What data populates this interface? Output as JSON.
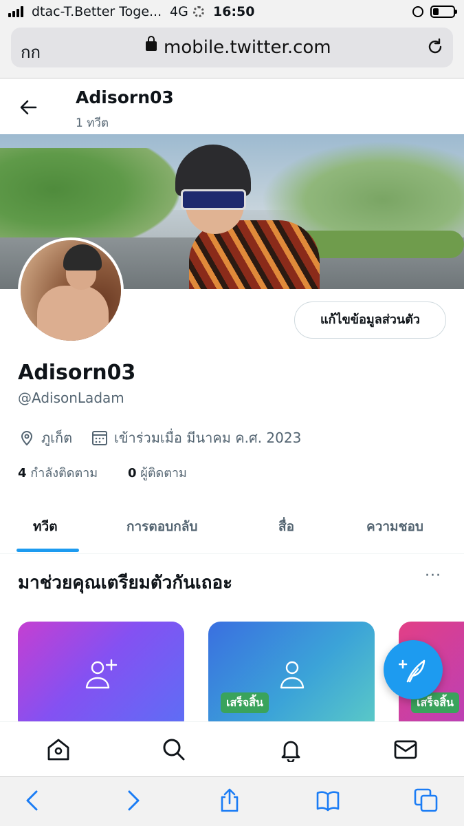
{
  "status_bar": {
    "carrier": "dtac-T.Better Toge...",
    "network": "4G",
    "time": "16:50"
  },
  "browser": {
    "aa_label": "กก",
    "domain": "mobile.twitter.com"
  },
  "header": {
    "name": "Adisorn03",
    "tweet_count": "1 ทวีต"
  },
  "profile": {
    "name": "Adisorn03",
    "handle": "@AdisonLadam",
    "edit_button": "แก้ไขข้อมูลส่วนตัว",
    "location": "ภูเก็ต",
    "joined": "เข้าร่วมเมื่อ มีนาคม ค.ศ. 2023",
    "following_count": "4",
    "following_label": "กำลังติดตาม",
    "followers_count": "0",
    "followers_label": "ผู้ติดตาม"
  },
  "tabs": [
    {
      "label": "ทวีต",
      "active": true
    },
    {
      "label": "การตอบกลับ",
      "active": false
    },
    {
      "label": "สื่อ",
      "active": false
    },
    {
      "label": "ความชอบ",
      "active": false
    }
  ],
  "onboarding": {
    "title": "มาช่วยคุณเตรียมตัวกันเถอะ",
    "more": "···",
    "done_label": "เสร็จสิ้น"
  },
  "colors": {
    "accent": "#1d9bf0",
    "done_badge": "#3aa35c"
  },
  "icons": {
    "bottom_nav": [
      "home-icon",
      "search-icon",
      "bell-icon",
      "mail-icon"
    ],
    "toolbar": [
      "back-icon",
      "forward-icon",
      "share-icon",
      "bookmarks-icon",
      "tabs-icon"
    ]
  }
}
